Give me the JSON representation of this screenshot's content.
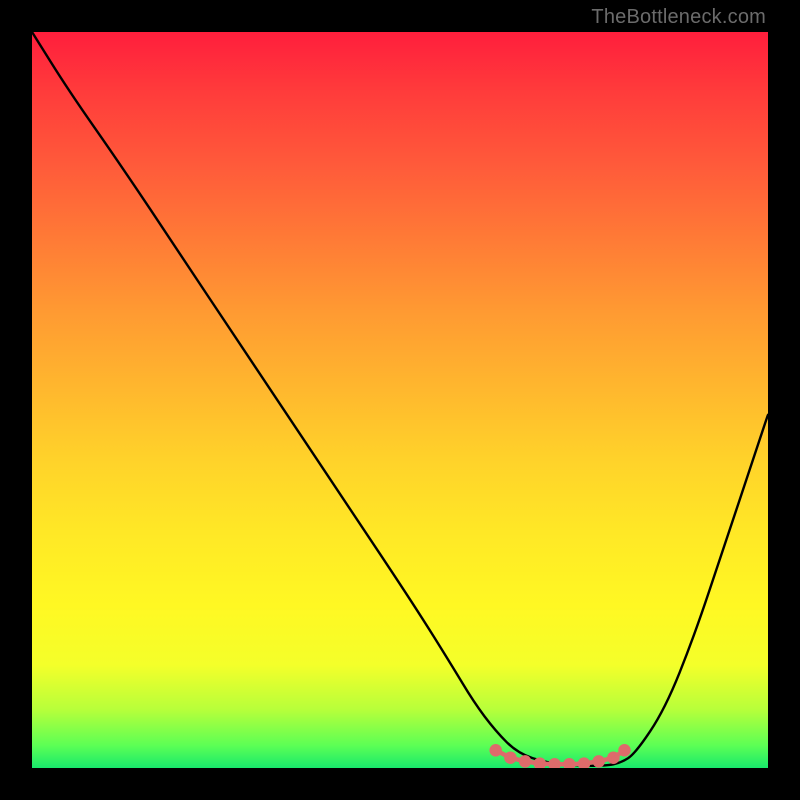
{
  "watermark": "TheBottleneck.com",
  "chart_data": {
    "type": "line",
    "title": "",
    "xlabel": "",
    "ylabel": "",
    "xlim": [
      0,
      100
    ],
    "ylim": [
      0,
      100
    ],
    "series": [
      {
        "name": "bottleneck-curve",
        "color": "#000000",
        "x": [
          0,
          5,
          12,
          20,
          28,
          36,
          44,
          52,
          57,
          60,
          63,
          66,
          70,
          74,
          78,
          80,
          82,
          86,
          90,
          94,
          98,
          100
        ],
        "y": [
          100,
          92,
          82,
          70,
          58,
          46,
          34,
          22,
          14,
          9,
          5,
          2,
          0.7,
          0.3,
          0.3,
          0.7,
          2,
          8,
          18,
          30,
          42,
          48
        ],
        "note": "y is percent height from bottom; valley floor ~0.3 between x≈70–78"
      },
      {
        "name": "valley-floor-markers",
        "color": "#e46a6a",
        "style": "dots-and-dashes",
        "x": [
          63,
          65,
          67,
          69,
          71,
          73,
          75,
          77,
          79,
          80.5
        ],
        "y": [
          2.4,
          1.4,
          0.9,
          0.6,
          0.5,
          0.5,
          0.6,
          0.9,
          1.4,
          2.4
        ]
      }
    ],
    "colors": {
      "gradient_top": "#ff1e3c",
      "gradient_bottom": "#18e86b",
      "curve": "#000000",
      "markers": "#e46a6a",
      "frame": "#000000"
    }
  }
}
